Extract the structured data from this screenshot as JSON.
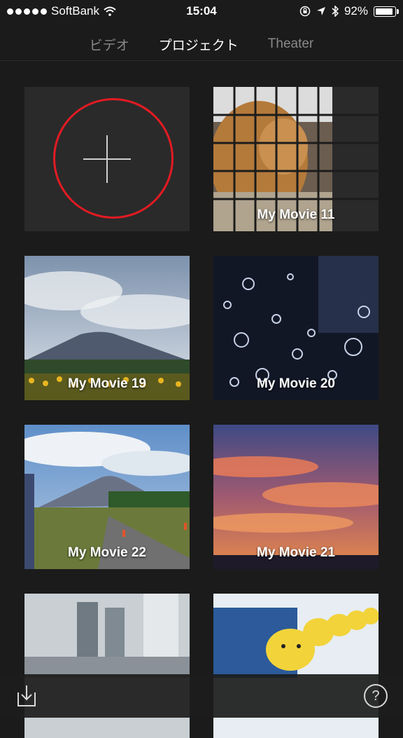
{
  "status_bar": {
    "carrier": "SoftBank",
    "time": "15:04",
    "battery": "92%",
    "battery_level": 0.92
  },
  "tabs": [
    {
      "label": "ビデオ",
      "active": false
    },
    {
      "label": "プロジェクト",
      "active": true
    },
    {
      "label": "Theater",
      "active": false
    }
  ],
  "projects": [
    {
      "title": "My Movie 11",
      "thumbnail": "lion-behind-cage"
    },
    {
      "title": "My Movie 19",
      "thumbnail": "mount-fuji-sunflowers"
    },
    {
      "title": "My Movie 20",
      "thumbnail": "water-bubbles"
    },
    {
      "title": "My Movie 22",
      "thumbnail": "mount-fuji-road"
    },
    {
      "title": "My Movie 21",
      "thumbnail": "sunset-clouds"
    },
    {
      "title": "",
      "thumbnail": "city-buildings"
    },
    {
      "title": "",
      "thumbnail": "pikachu-parade"
    }
  ],
  "new_project_button": {
    "icon": "plus-icon",
    "accent": "#e21b23"
  },
  "bottom_bar": {
    "import_icon": "import-icon",
    "help_label": "?"
  }
}
